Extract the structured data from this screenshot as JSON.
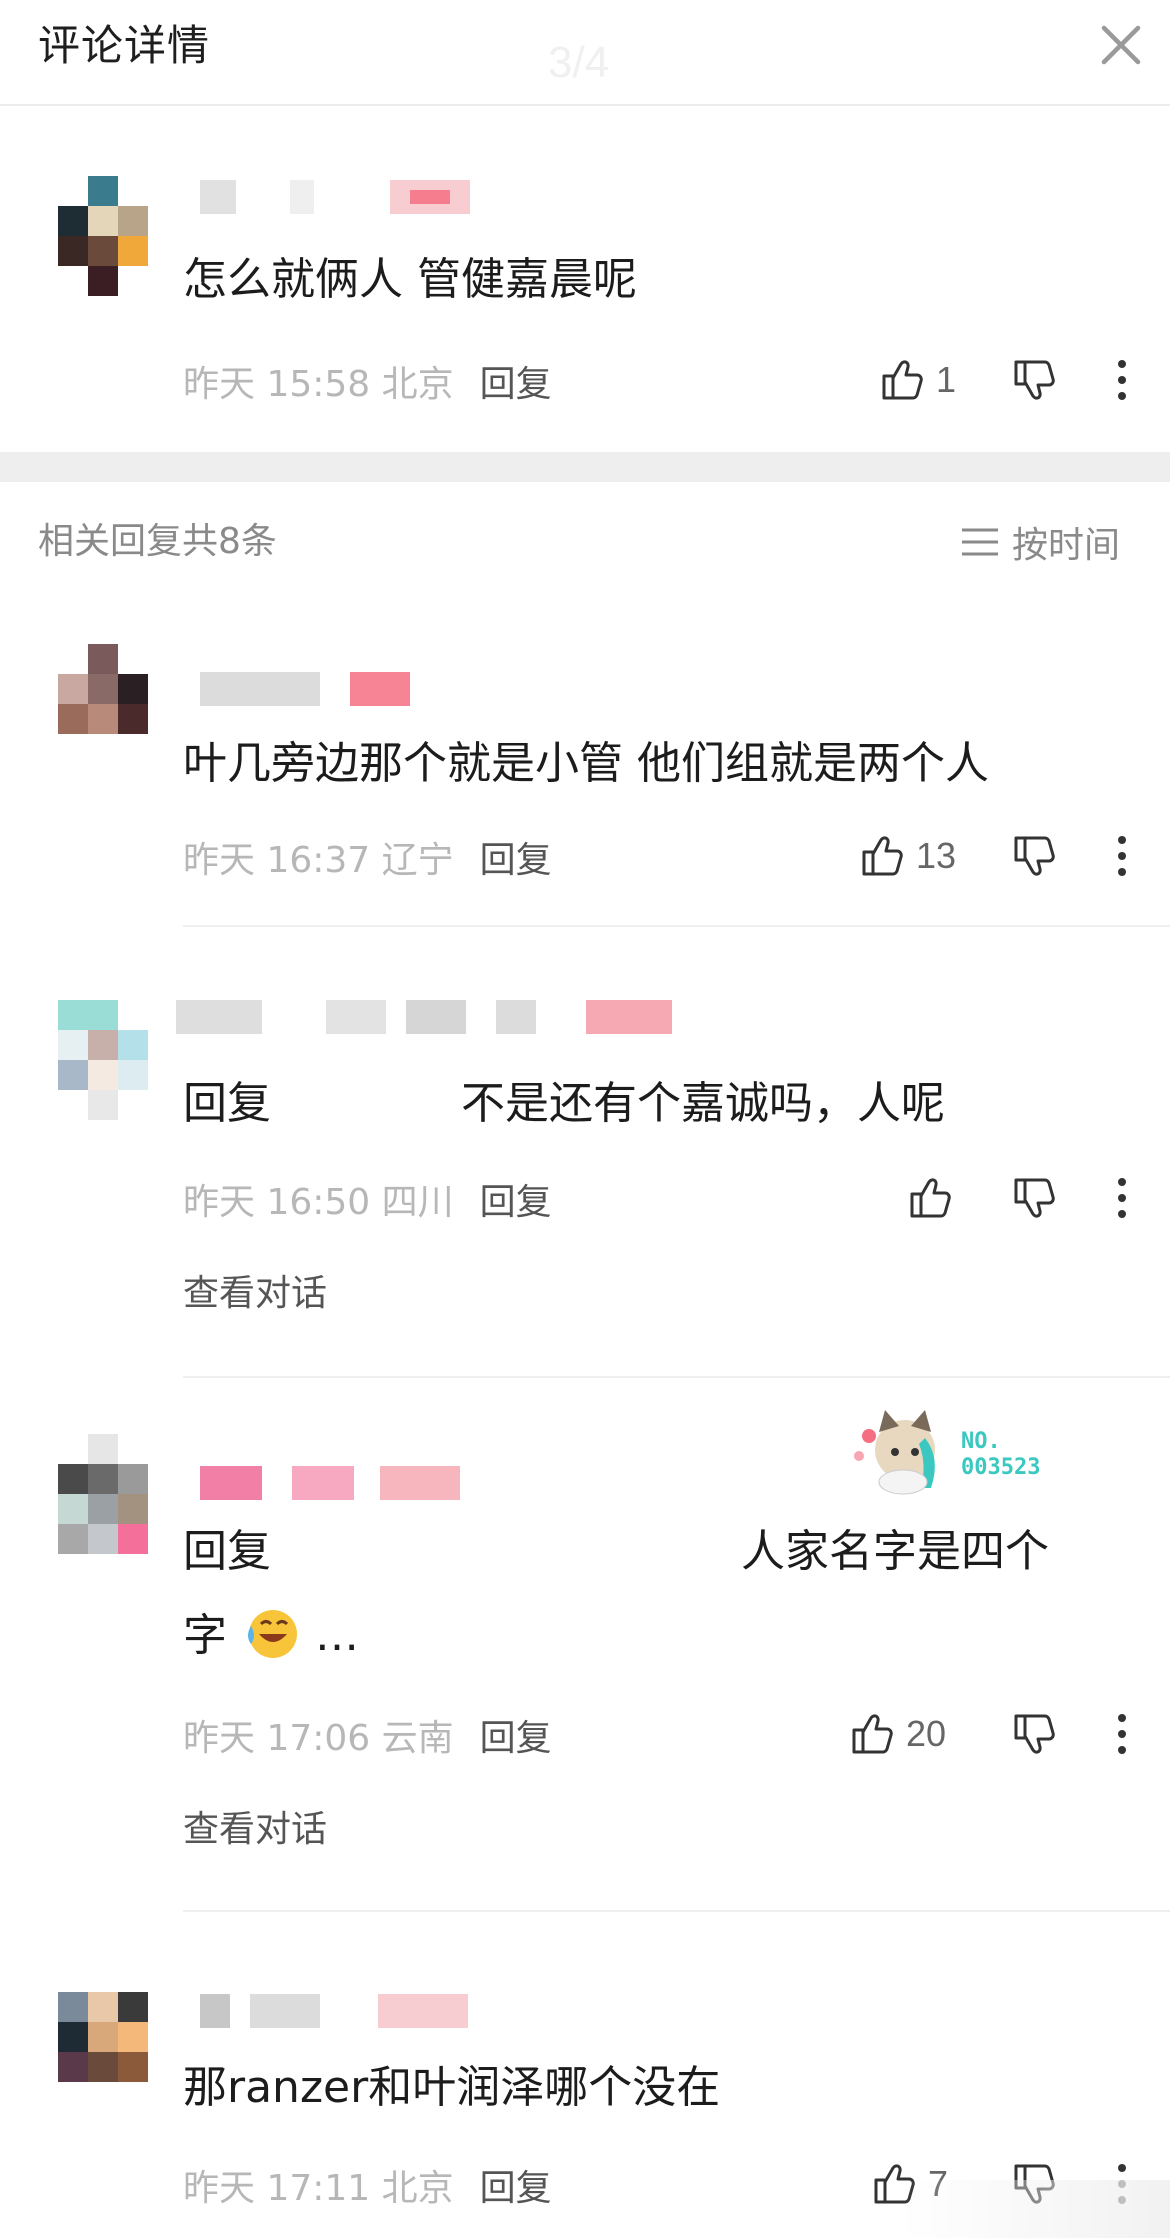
{
  "header": {
    "title": "评论详情",
    "counter": "3/4"
  },
  "colors": {
    "accent_pink": "#f46f82",
    "meta_gray": "#b7b7b7",
    "text": "#1c1c1c"
  },
  "main_comment": {
    "text": "怎么就俩人 管健嘉晨呢",
    "time": "昨天 15:58 北京",
    "reply": "回复",
    "likes": "1"
  },
  "section": {
    "label": "相关回复共8条",
    "sort_label": "按时间",
    "sort_icon": "menu-icon"
  },
  "replies": [
    {
      "text": "叶几旁边那个就是小管 他们组就是两个人",
      "time": "昨天 16:37 辽宁",
      "reply": "回复",
      "likes": "13"
    },
    {
      "prefix": "回复",
      "text": "不是还有个嘉诚吗，人呢",
      "time": "昨天 16:50 四川",
      "reply": "回复",
      "likes": "",
      "view": "查看对话"
    },
    {
      "prefix": "回复",
      "text": "人家名字是四个",
      "text2": "字",
      "ellipsis": "…",
      "time": "昨天 17:06 云南",
      "reply": "回复",
      "likes": "20",
      "view": "查看对话",
      "badge_text": "NO.\n003523"
    },
    {
      "text": "那ranzer和叶润泽哪个没在",
      "time": "昨天 17:11 北京",
      "reply": "回复",
      "likes": "7"
    }
  ]
}
